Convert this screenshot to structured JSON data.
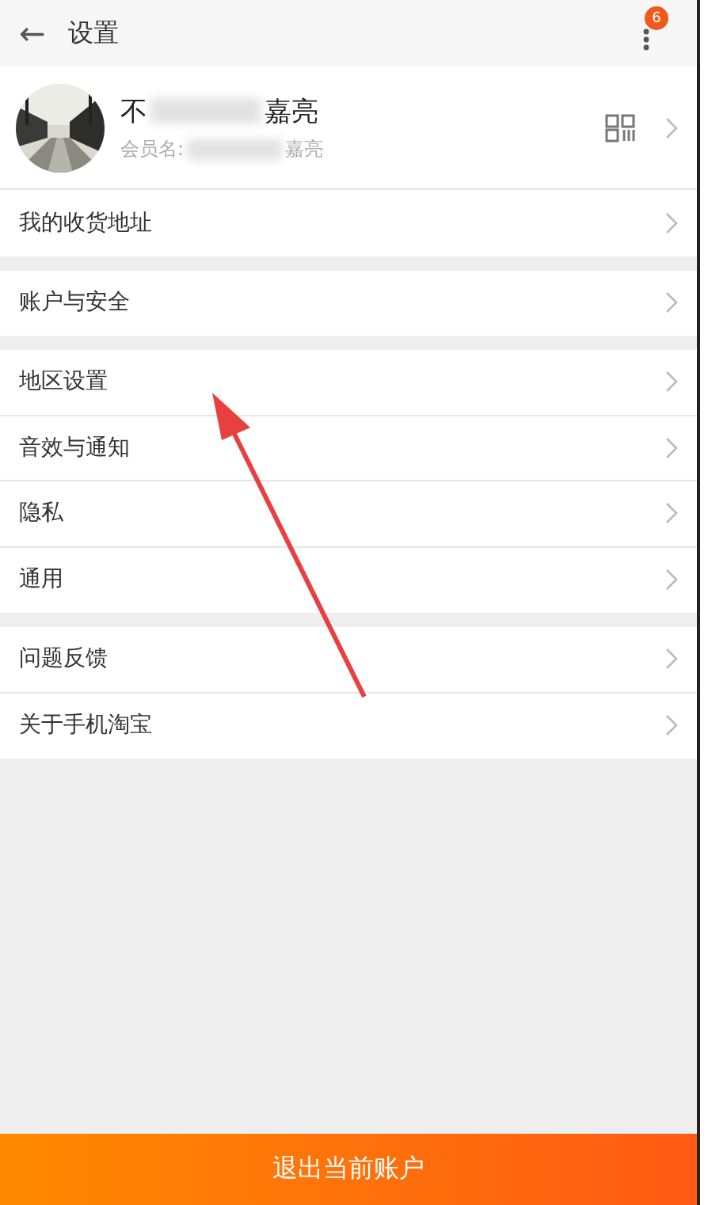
{
  "header": {
    "back": "←",
    "title": "设置",
    "menu_badge": "6"
  },
  "profile": {
    "name_start": "不",
    "name_end": "嘉亮",
    "member_label": "会员名:",
    "member_end": "嘉亮"
  },
  "groups": [
    {
      "items": [
        {
          "label": "我的收货地址"
        }
      ]
    },
    {
      "items": [
        {
          "label": "账户与安全"
        }
      ]
    },
    {
      "items": [
        {
          "label": "地区设置"
        },
        {
          "label": "音效与通知"
        },
        {
          "label": "隐私"
        },
        {
          "label": "通用"
        }
      ]
    },
    {
      "items": [
        {
          "label": "问题反馈"
        },
        {
          "label": "关于手机淘宝"
        }
      ]
    }
  ],
  "logout_button": "退出当前账户"
}
